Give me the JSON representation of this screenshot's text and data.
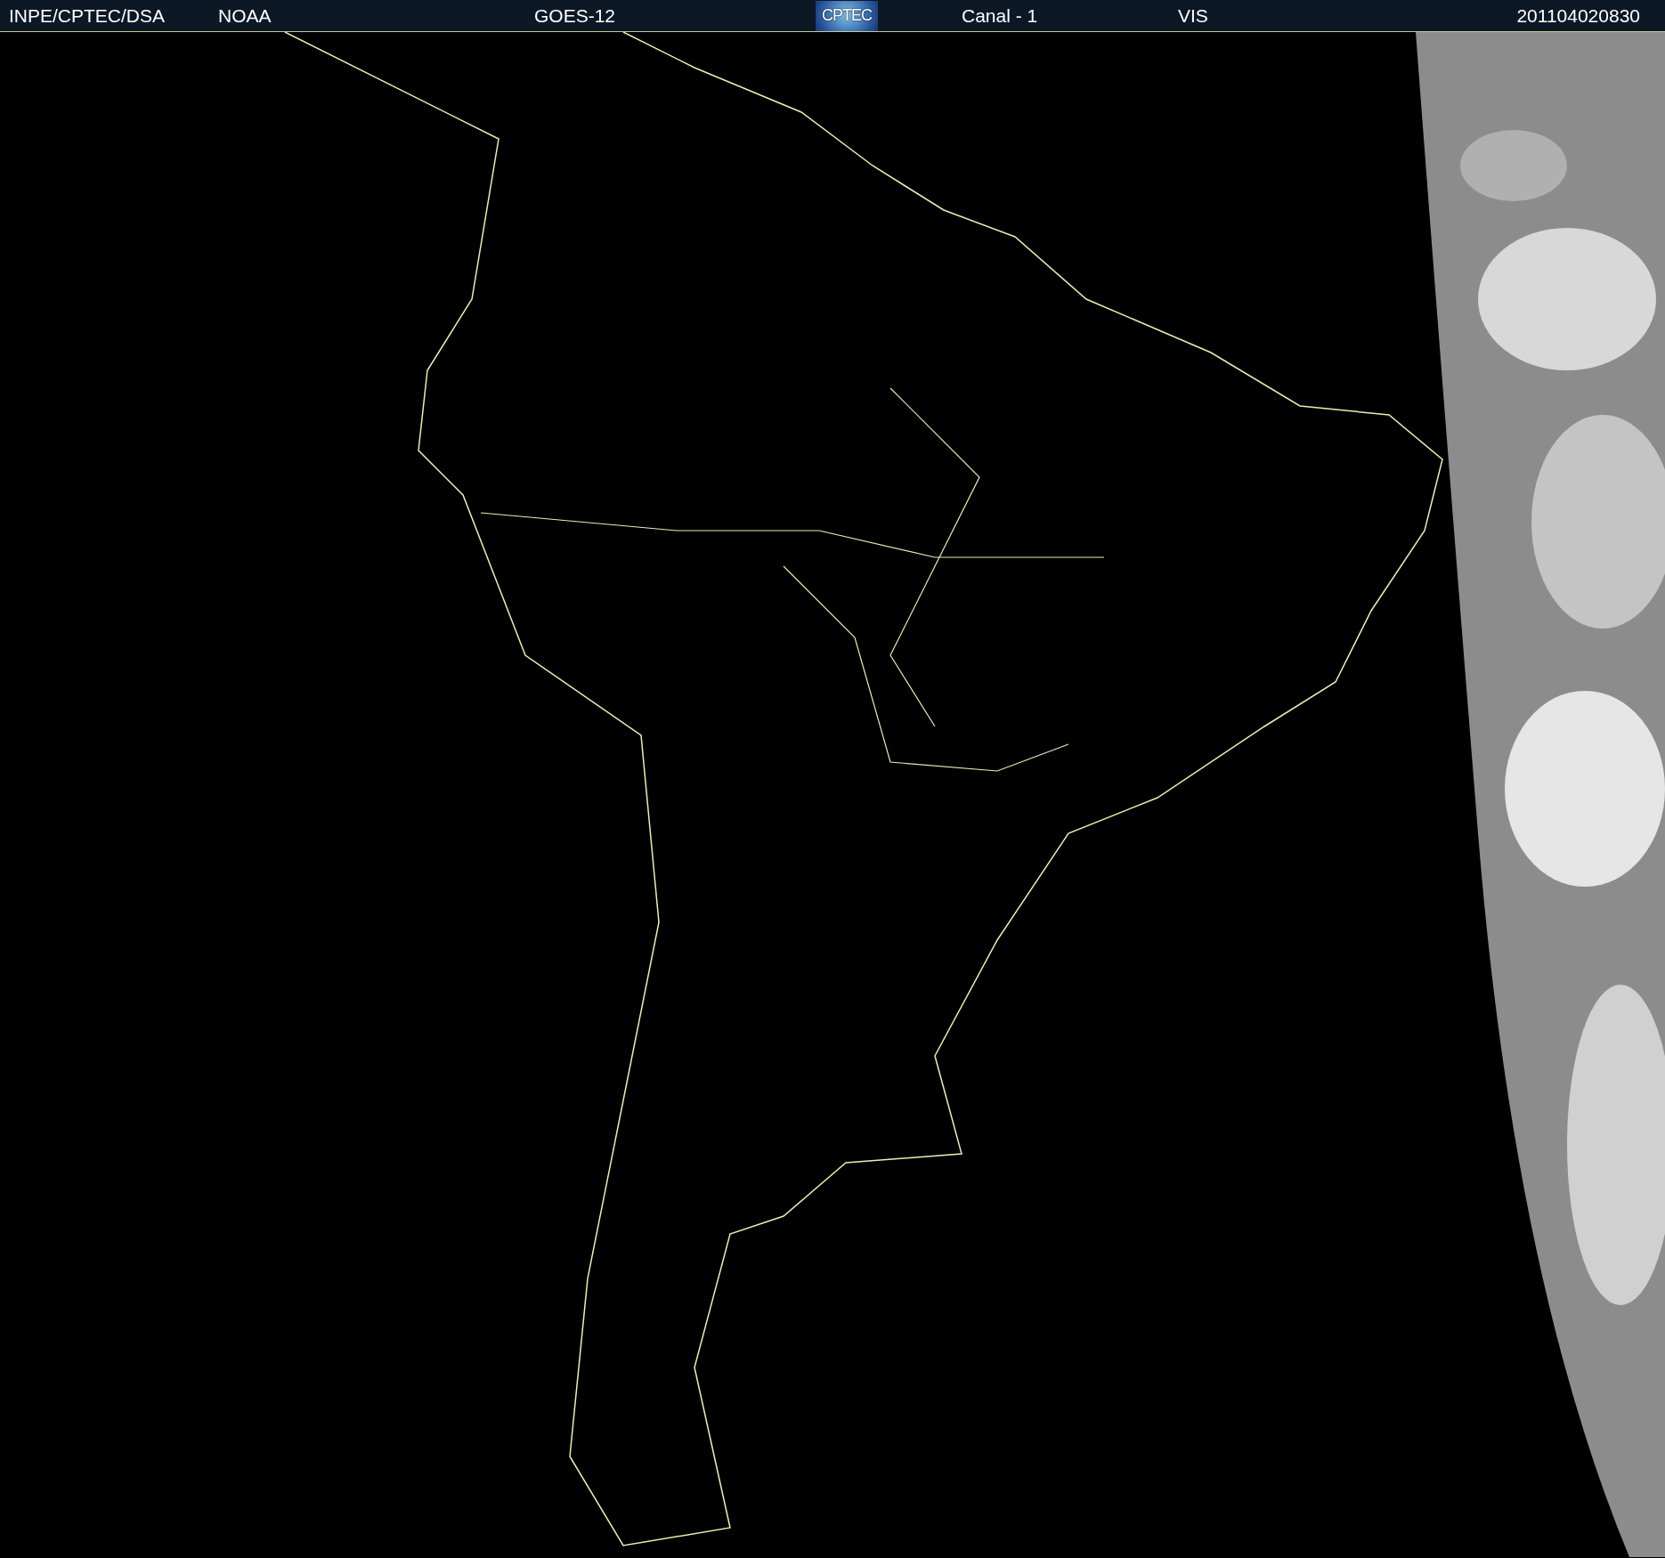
{
  "header": {
    "items": [
      {
        "kind": "text",
        "text": "INPE/CPTEC/DSA"
      },
      {
        "kind": "text",
        "text": "NOAA"
      },
      {
        "kind": "text",
        "text": "GOES-12"
      },
      {
        "kind": "logo",
        "text": "CPTEC"
      },
      {
        "kind": "text",
        "text": "Canal - 1"
      },
      {
        "kind": "text",
        "text": "VIS"
      },
      {
        "kind": "text",
        "text": "201104020830"
      }
    ]
  }
}
